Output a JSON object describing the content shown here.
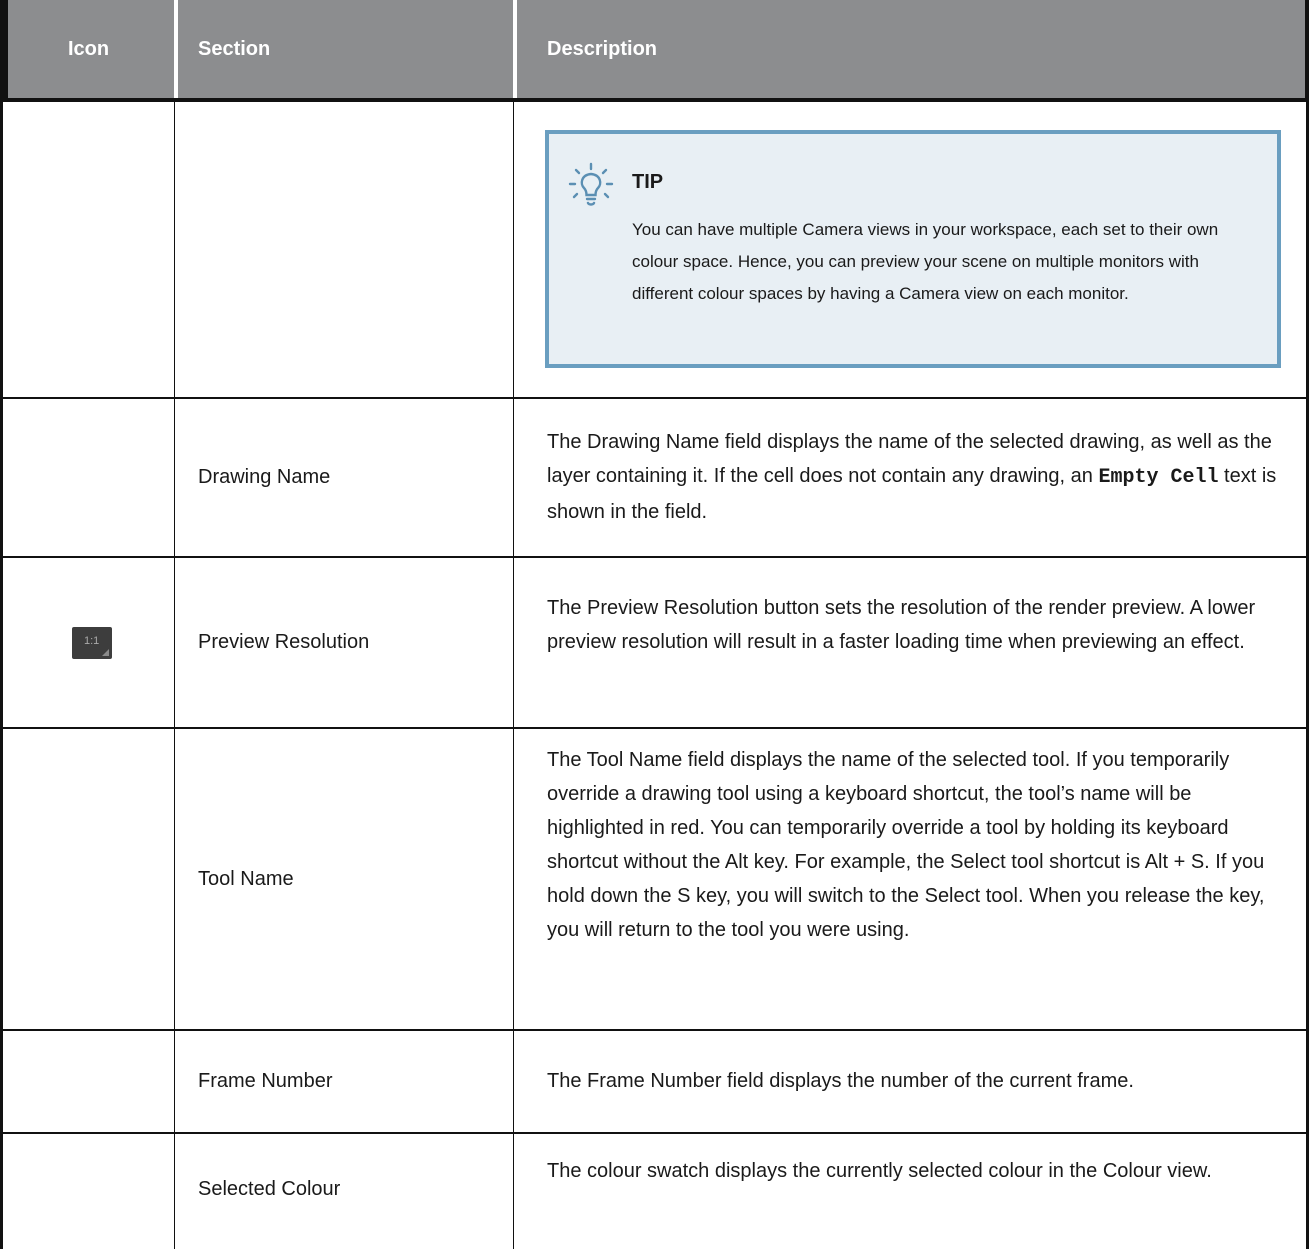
{
  "table": {
    "headers": {
      "icon": "Icon",
      "section": "Section",
      "description": "Description"
    }
  },
  "tip": {
    "icon": "lightbulb-icon",
    "title": "TIP",
    "body": "You can have multiple Camera views in your workspace, each set to their own colour space. Hence, you can preview your scene on multiple monitors with different colour spaces by having a Camera view on each monitor."
  },
  "rows": [
    {
      "section": "Drawing Name",
      "description_before": "The Drawing Name field displays the name of the selected drawing, as well as the layer containing it. If the cell does not contain any drawing, an ",
      "description_code": "Empty Cell",
      "description_after": " text is shown in the field."
    },
    {
      "icon_label": "1:1",
      "icon": "preview-resolution-icon",
      "section": "Preview Resolution",
      "description": "The Preview Resolution button sets the resolution of the render preview. A lower preview resolution will result in a faster loading time when previewing an effect."
    },
    {
      "section": "Tool Name",
      "description": "The Tool Name field displays the name of the selected tool. If you temporarily override a drawing tool using a keyboard shortcut, the tool’s name will be highlighted in red. You can temporarily override a tool by holding its keyboard shortcut without the Alt key. For example, the Select tool shortcut is Alt + S. If you hold down the S key, you will switch to the Select tool. When you release the key, you will return to the tool you were using."
    },
    {
      "section": "Frame Number",
      "description": "The Frame Number field displays the number of the current frame."
    },
    {
      "section": "Selected Colour",
      "description": "The colour swatch displays the currently selected colour in the Colour view."
    }
  ]
}
